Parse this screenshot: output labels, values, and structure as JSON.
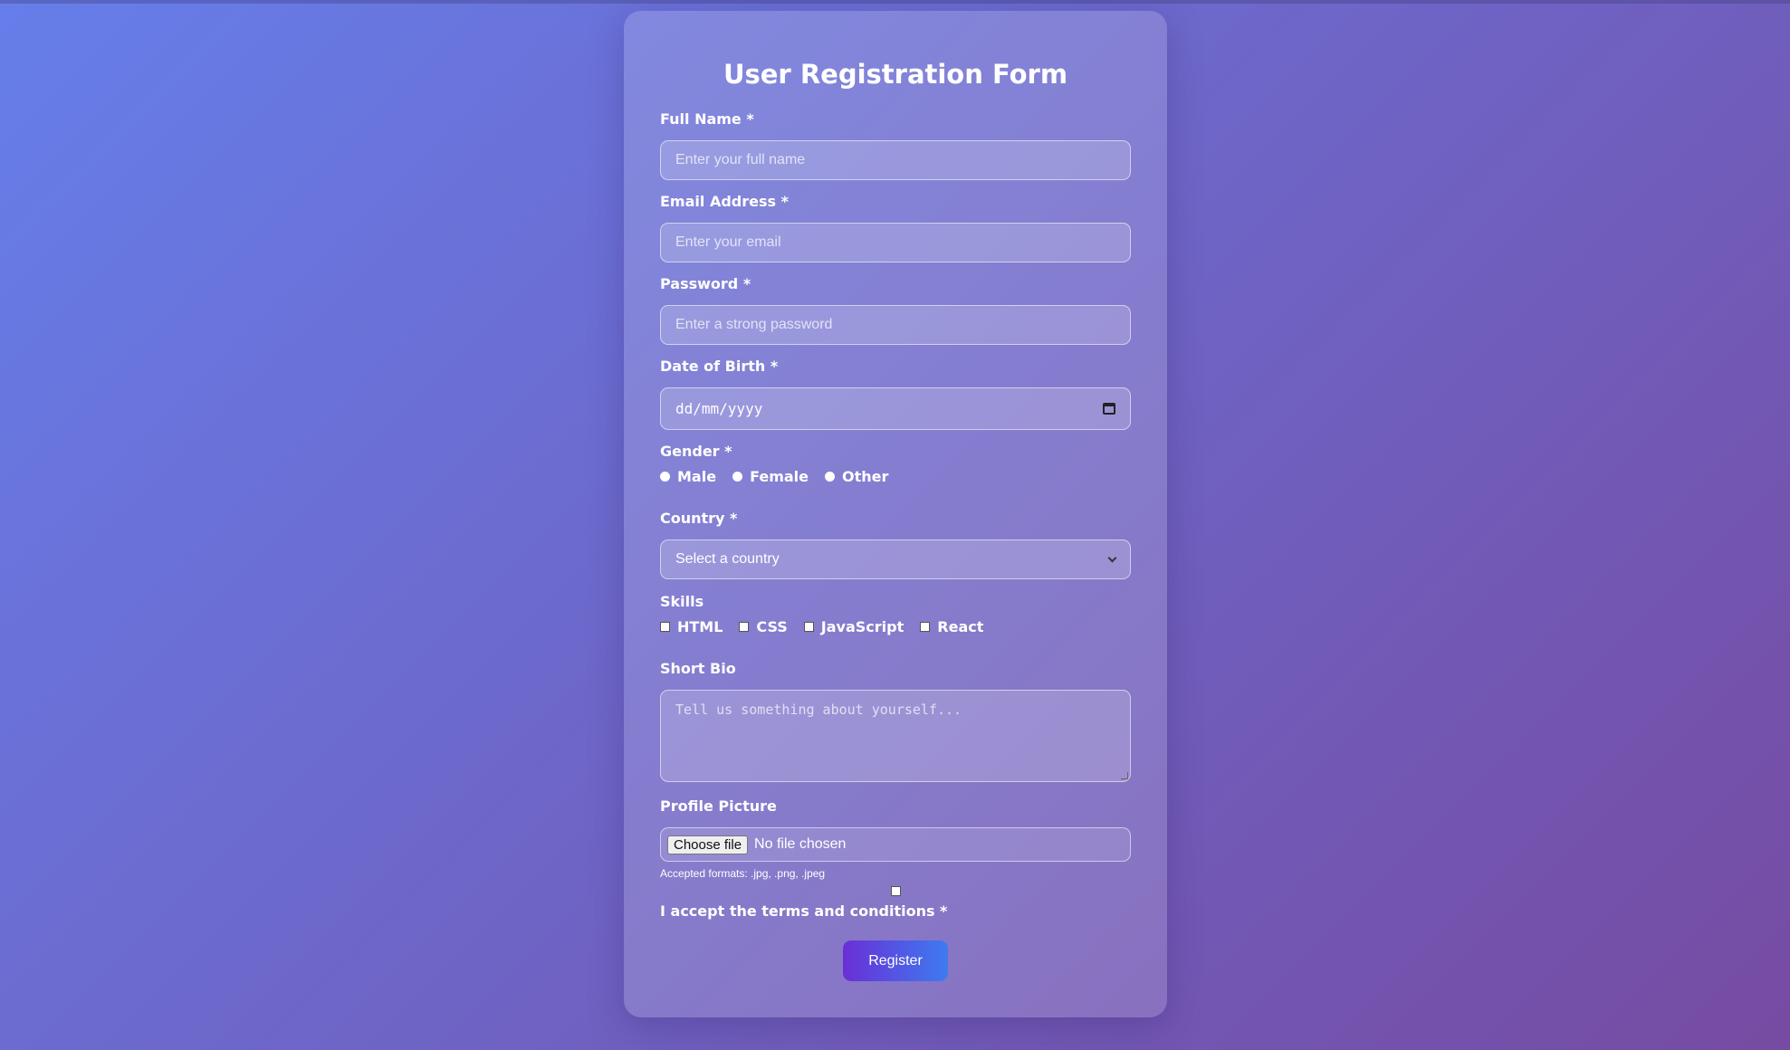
{
  "form": {
    "title": "User Registration Form",
    "full_name": {
      "label": "Full Name *",
      "placeholder": "Enter your full name"
    },
    "email": {
      "label": "Email Address *",
      "placeholder": "Enter your email"
    },
    "password": {
      "label": "Password *",
      "placeholder": "Enter a strong password"
    },
    "dob": {
      "label": "Date of Birth *",
      "value": "dd/mm/yyyy"
    },
    "gender": {
      "label": "Gender *",
      "options": [
        "Male",
        "Female",
        "Other"
      ]
    },
    "country": {
      "label": "Country *",
      "selected": "Select a country"
    },
    "skills": {
      "label": "Skills",
      "options": [
        "HTML",
        "CSS",
        "JavaScript",
        "React"
      ]
    },
    "bio": {
      "label": "Short Bio",
      "placeholder": "Tell us something about yourself..."
    },
    "profile_picture": {
      "label": "Profile Picture",
      "button_label": "Choose file",
      "status": "No file chosen",
      "hint": "Accepted formats: .jpg, .png, .jpeg"
    },
    "terms": {
      "label": "I accept the terms and conditions *"
    },
    "submit_label": "Register"
  },
  "colors": {
    "background_start": "#667eea",
    "background_end": "#764ba2",
    "button_start": "#6a2fd6",
    "button_end": "#3d7bf0"
  }
}
